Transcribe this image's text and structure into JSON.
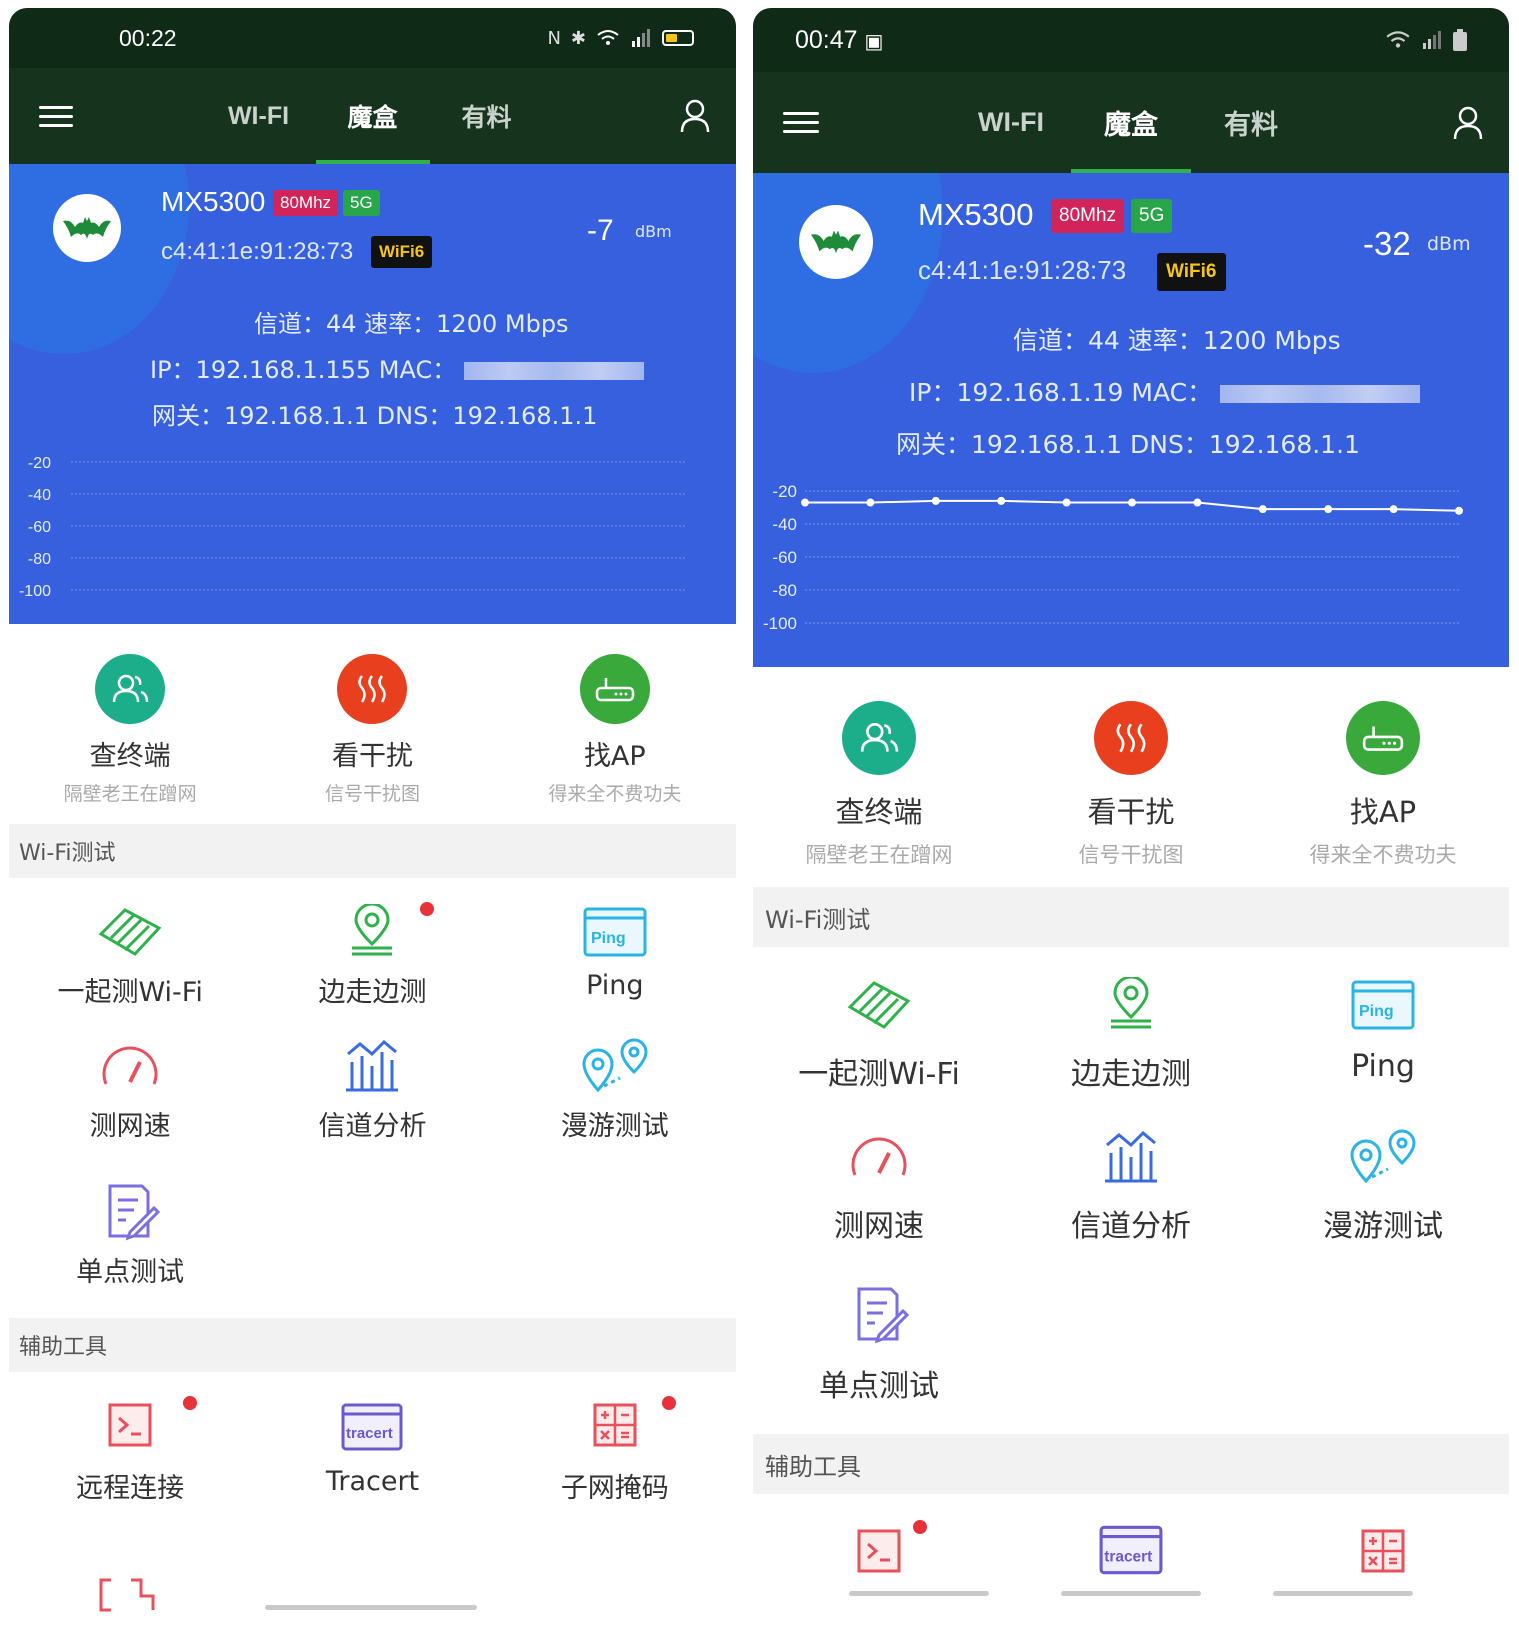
{
  "screens": [
    {
      "status": {
        "time": "00:22"
      },
      "tabs": [
        "WI-FI",
        "魔盒",
        "有料"
      ],
      "active_tab": 1,
      "wifi": {
        "ssid": "MX5300",
        "band_width": "80Mhz",
        "band": "5G",
        "bssid": "c4:41:1e:91:28:73",
        "standard": "WiFi6",
        "signal": "-7",
        "signal_unit": "dBm",
        "channel_line": "信道：44   速率：1200 Mbps",
        "ip_line": "IP：192.168.1.155   MAC：",
        "gateway_line": "网关：192.168.1.1   DNS：192.168.1.1"
      },
      "chart_data": {
        "type": "line",
        "y_ticks": [
          "-20",
          "-40",
          "-60",
          "-80",
          "-100"
        ],
        "ylim": [
          -100,
          -20
        ],
        "series": []
      },
      "features": [
        {
          "title": "查终端",
          "subtitle": "隔壁老王在蹭网",
          "icon": "users-icon",
          "color": "#1cae8a"
        },
        {
          "title": "看干扰",
          "subtitle": "信号干扰图",
          "icon": "heat-icon",
          "color": "#e8401f"
        },
        {
          "title": "找AP",
          "subtitle": "得来全不费功夫",
          "icon": "router-icon",
          "color": "#38a93a"
        }
      ],
      "wifi_test_section": "Wi-Fi测试",
      "wifi_tests": [
        {
          "label": "一起测Wi-Fi",
          "icon": "wifi-test-icon",
          "dot": false
        },
        {
          "label": "边走边测",
          "icon": "location-icon",
          "dot": true
        },
        {
          "label": "Ping",
          "icon": "ping-icon",
          "dot": false
        },
        {
          "label": "测网速",
          "icon": "speed-gauge-icon",
          "dot": false
        },
        {
          "label": "信道分析",
          "icon": "channel-chart-icon",
          "dot": false
        },
        {
          "label": "漫游测试",
          "icon": "roaming-icon",
          "dot": false
        },
        {
          "label": "单点测试",
          "icon": "single-point-icon",
          "dot": false
        }
      ],
      "tools_section": "辅助工具",
      "tools": [
        {
          "label": "远程连接",
          "icon": "terminal-icon",
          "dot": true
        },
        {
          "label": "Tracert",
          "icon": "tracert-icon",
          "dot": false
        },
        {
          "label": "子网掩码",
          "icon": "calculator-icon",
          "dot": true
        }
      ],
      "icon_texts": {
        "ping": "Ping",
        "tracert": "tracert"
      }
    },
    {
      "status": {
        "time": "00:47"
      },
      "tabs": [
        "WI-FI",
        "魔盒",
        "有料"
      ],
      "active_tab": 1,
      "wifi": {
        "ssid": "MX5300",
        "band_width": "80Mhz",
        "band": "5G",
        "bssid": "c4:41:1e:91:28:73",
        "standard": "WiFi6",
        "signal": "-32",
        "signal_unit": "dBm",
        "channel_line": "信道：44   速率：1200 Mbps",
        "ip_line": "IP：192.168.1.19   MAC：",
        "gateway_line": "网关：192.168.1.1   DNS：192.168.1.1"
      },
      "chart_data": {
        "type": "line",
        "y_ticks": [
          "-20",
          "-40",
          "-60",
          "-80",
          "-100"
        ],
        "ylim": [
          -100,
          -20
        ],
        "series": [
          {
            "values": [
              -27,
              -27,
              -26,
              -26,
              -27,
              -27,
              -27,
              -31,
              -31,
              -31,
              -32
            ]
          }
        ]
      },
      "features": [
        {
          "title": "查终端",
          "subtitle": "隔壁老王在蹭网",
          "icon": "users-icon",
          "color": "#1cae8a"
        },
        {
          "title": "看干扰",
          "subtitle": "信号干扰图",
          "icon": "heat-icon",
          "color": "#e8401f"
        },
        {
          "title": "找AP",
          "subtitle": "得来全不费功夫",
          "icon": "router-icon",
          "color": "#38a93a"
        }
      ],
      "wifi_test_section": "Wi-Fi测试",
      "wifi_tests": [
        {
          "label": "一起测Wi-Fi",
          "icon": "wifi-test-icon",
          "dot": false
        },
        {
          "label": "边走边测",
          "icon": "location-icon",
          "dot": false
        },
        {
          "label": "Ping",
          "icon": "ping-icon",
          "dot": false
        },
        {
          "label": "测网速",
          "icon": "speed-gauge-icon",
          "dot": false
        },
        {
          "label": "信道分析",
          "icon": "channel-chart-icon",
          "dot": false
        },
        {
          "label": "漫游测试",
          "icon": "roaming-icon",
          "dot": false
        },
        {
          "label": "单点测试",
          "icon": "single-point-icon",
          "dot": false
        }
      ],
      "tools_section": "辅助工具",
      "tools": [
        {
          "label": "",
          "icon": "terminal-icon",
          "dot": true
        },
        {
          "label": "",
          "icon": "tracert-icon",
          "dot": false
        },
        {
          "label": "",
          "icon": "calculator-icon",
          "dot": false
        }
      ],
      "icon_texts": {
        "ping": "Ping",
        "tracert": "tracert"
      }
    }
  ]
}
